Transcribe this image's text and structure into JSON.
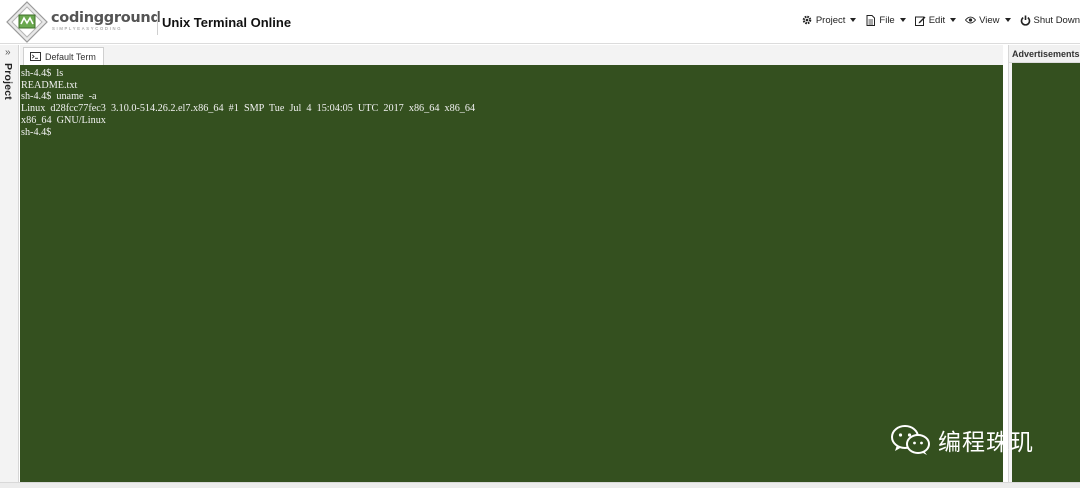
{
  "header": {
    "logo": {
      "name": "codingground",
      "tagline": "SIMPLYEASYCODING"
    },
    "app_title": "Unix Terminal Online",
    "menu": [
      {
        "label": "Project",
        "icon": "gear-icon"
      },
      {
        "label": "File",
        "icon": "file-icon"
      },
      {
        "label": "Edit",
        "icon": "edit-icon"
      },
      {
        "label": "View",
        "icon": "eye-icon"
      },
      {
        "label": "Shut Down",
        "icon": "power-icon"
      }
    ]
  },
  "sidebar": {
    "toggle": "»",
    "label": "Project"
  },
  "tabs": [
    {
      "label": "Default Term",
      "icon": "terminal-icon"
    }
  ],
  "terminal": {
    "lines": [
      "sh-4.4$  ls",
      "README.txt",
      "sh-4.4$  uname  -a",
      "Linux  d28fcc77fec3  3.10.0-514.26.2.el7.x86_64  #1  SMP  Tue  Jul  4  15:04:05  UTC  2017  x86_64  x86_64",
      "x86_64  GNU/Linux",
      "sh-4.4$"
    ]
  },
  "right_panel": {
    "title": "Advertisements"
  },
  "watermark": {
    "text": "编程珠玑"
  },
  "colors": {
    "terminal_bg": "#34501f",
    "terminal_fg": "#f2f2f2",
    "panel_bg": "#f3f3f3",
    "border": "#d6d6d6"
  }
}
